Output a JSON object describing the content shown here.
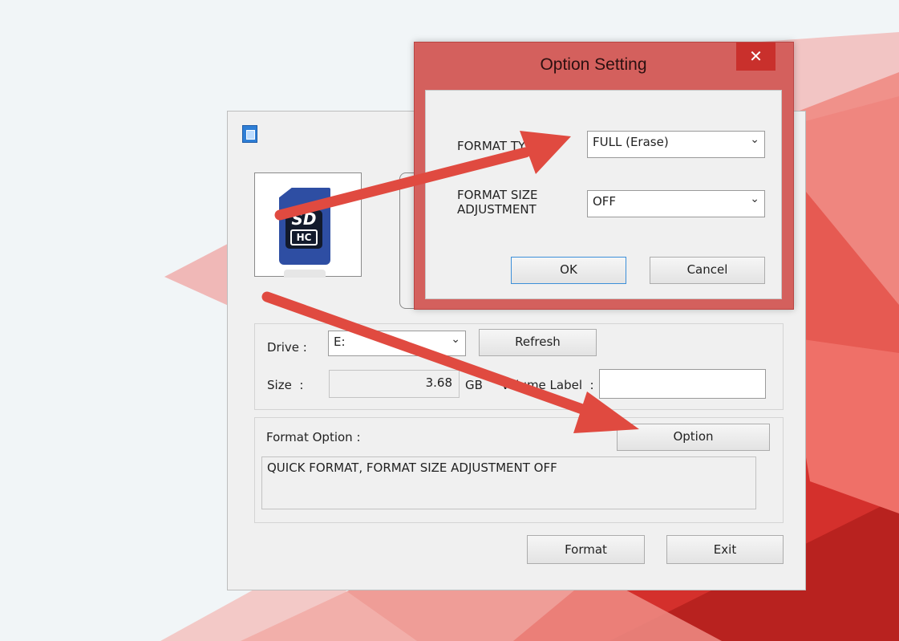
{
  "colors": {
    "dialog_frame": "#d4605d",
    "close_button": "#c9302c",
    "arrow": "#e04a40",
    "background_red": "#d8322e"
  },
  "main_window": {
    "drive_label": "Drive :",
    "drive_value": "E:",
    "refresh_label": "Refresh",
    "size_label": "Size  :",
    "size_value": "3.68",
    "size_unit": "GB",
    "volume_label": "Volume Label  :",
    "volume_value": "",
    "format_option_label": "Format Option :",
    "option_button": "Option",
    "format_option_text": "QUICK FORMAT, FORMAT SIZE ADJUSTMENT OFF",
    "format_button": "Format",
    "exit_button": "Exit",
    "card_logo_top": "SD",
    "card_logo_bottom": "HC"
  },
  "option_dialog": {
    "title": "Option Setting",
    "close_glyph": "✕",
    "format_type_label": "FORMAT TYPE",
    "format_type_value": "FULL (Erase)",
    "format_size_label_line1": "FORMAT SIZE",
    "format_size_label_line2": "ADJUSTMENT",
    "format_size_value": "OFF",
    "ok_button": "OK",
    "cancel_button": "Cancel",
    "dropdown_icon": "chevron-down-icon"
  }
}
